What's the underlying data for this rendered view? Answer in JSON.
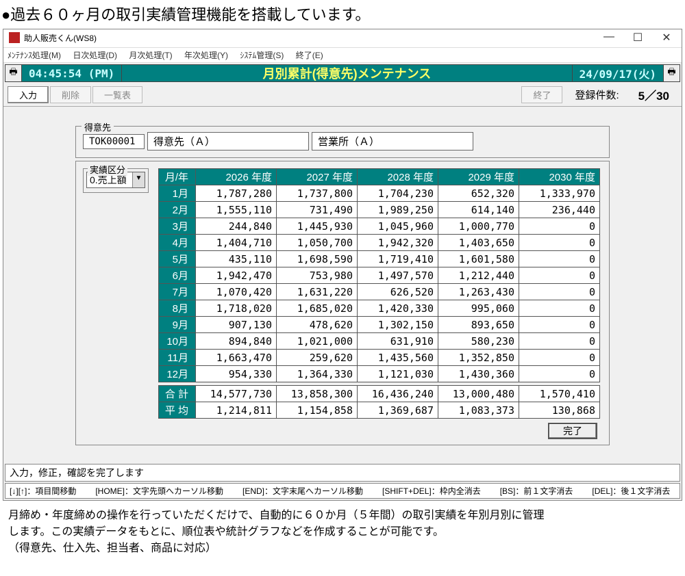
{
  "headline": "●過去６０ヶ月の取引実績管理機能を搭載しています。",
  "window": {
    "title": "助人販売くん(WS8)",
    "minimize": "—",
    "maximize": "☐",
    "close": "✕"
  },
  "menu": {
    "m1": "ﾒﾝﾃﾅﾝｽ処理(M)",
    "m2": "日次処理(D)",
    "m3": "月次処理(T)",
    "m4": "年次処理(Y)",
    "m5": "ｼｽﾃﾑ管理(S)",
    "m6": "終了(E)"
  },
  "infobar": {
    "clock": "04:45:54 (PM)",
    "title": "月別累計(得意先)メンテナンス",
    "date": "24/09/17(火)"
  },
  "toolbar": {
    "input": "入力",
    "delete": "削除",
    "list": "一覧表",
    "exit": "終了",
    "reg_label": "登録件数:",
    "reg_count": "5／30"
  },
  "customer": {
    "legend": "得意先",
    "code": "TOK00001",
    "name": "得意先（Ａ）",
    "office": "営業所（Ａ）"
  },
  "kubun": {
    "legend": "実績区分",
    "selected": "0.売上額"
  },
  "grid": {
    "header_month": "月/年",
    "years": [
      "2026 年度",
      "2027 年度",
      "2028 年度",
      "2029 年度",
      "2030 年度"
    ],
    "months": [
      "1月",
      "2月",
      "3月",
      "4月",
      "5月",
      "6月",
      "7月",
      "8月",
      "9月",
      "10月",
      "11月",
      "12月"
    ],
    "data": [
      [
        "1,787,280",
        "1,737,800",
        "1,704,230",
        "652,320",
        "1,333,970"
      ],
      [
        "1,555,110",
        "731,490",
        "1,989,250",
        "614,140",
        "236,440"
      ],
      [
        "244,840",
        "1,445,930",
        "1,045,960",
        "1,000,770",
        "0"
      ],
      [
        "1,404,710",
        "1,050,700",
        "1,942,320",
        "1,403,650",
        "0"
      ],
      [
        "435,110",
        "1,698,590",
        "1,719,410",
        "1,601,580",
        "0"
      ],
      [
        "1,942,470",
        "753,980",
        "1,497,570",
        "1,212,440",
        "0"
      ],
      [
        "1,070,420",
        "1,631,220",
        "626,520",
        "1,263,430",
        "0"
      ],
      [
        "1,718,020",
        "1,685,020",
        "1,420,330",
        "995,060",
        "0"
      ],
      [
        "907,130",
        "478,620",
        "1,302,150",
        "893,650",
        "0"
      ],
      [
        "894,840",
        "1,021,000",
        "631,910",
        "580,230",
        "0"
      ],
      [
        "1,663,470",
        "259,620",
        "1,435,560",
        "1,352,850",
        "0"
      ],
      [
        "954,330",
        "1,364,330",
        "1,121,030",
        "1,430,360",
        "0"
      ]
    ],
    "total_label": "合 計",
    "totals": [
      "14,577,730",
      "13,858,300",
      "16,436,240",
      "13,000,480",
      "1,570,410"
    ],
    "avg_label": "平 均",
    "averages": [
      "1,214,811",
      "1,154,858",
      "1,369,687",
      "1,083,373",
      "130,868"
    ],
    "done": "完了"
  },
  "status": {
    "line1": "入力，修正，確認を完了します",
    "k1": "[↓][↑]：項目間移動",
    "k2": "[HOME]：文字先頭へカーソル移動",
    "k3": "[END]：文字末尾へカーソル移動",
    "k4": "[SHIFT+DEL]：枠内全消去",
    "k5": "[BS]：前１文字消去",
    "k6": "[DEL]：後１文字消去"
  },
  "footer": {
    "l1": "月締め・年度締めの操作を行っていただくだけで、自動的に６０か月（５年間）の取引実績を年別月別に管理",
    "l2": "します。この実績データをもとに、順位表や統計グラフなどを作成することが可能です。",
    "l3": "（得意先、仕入先、担当者、商品に対応）"
  }
}
